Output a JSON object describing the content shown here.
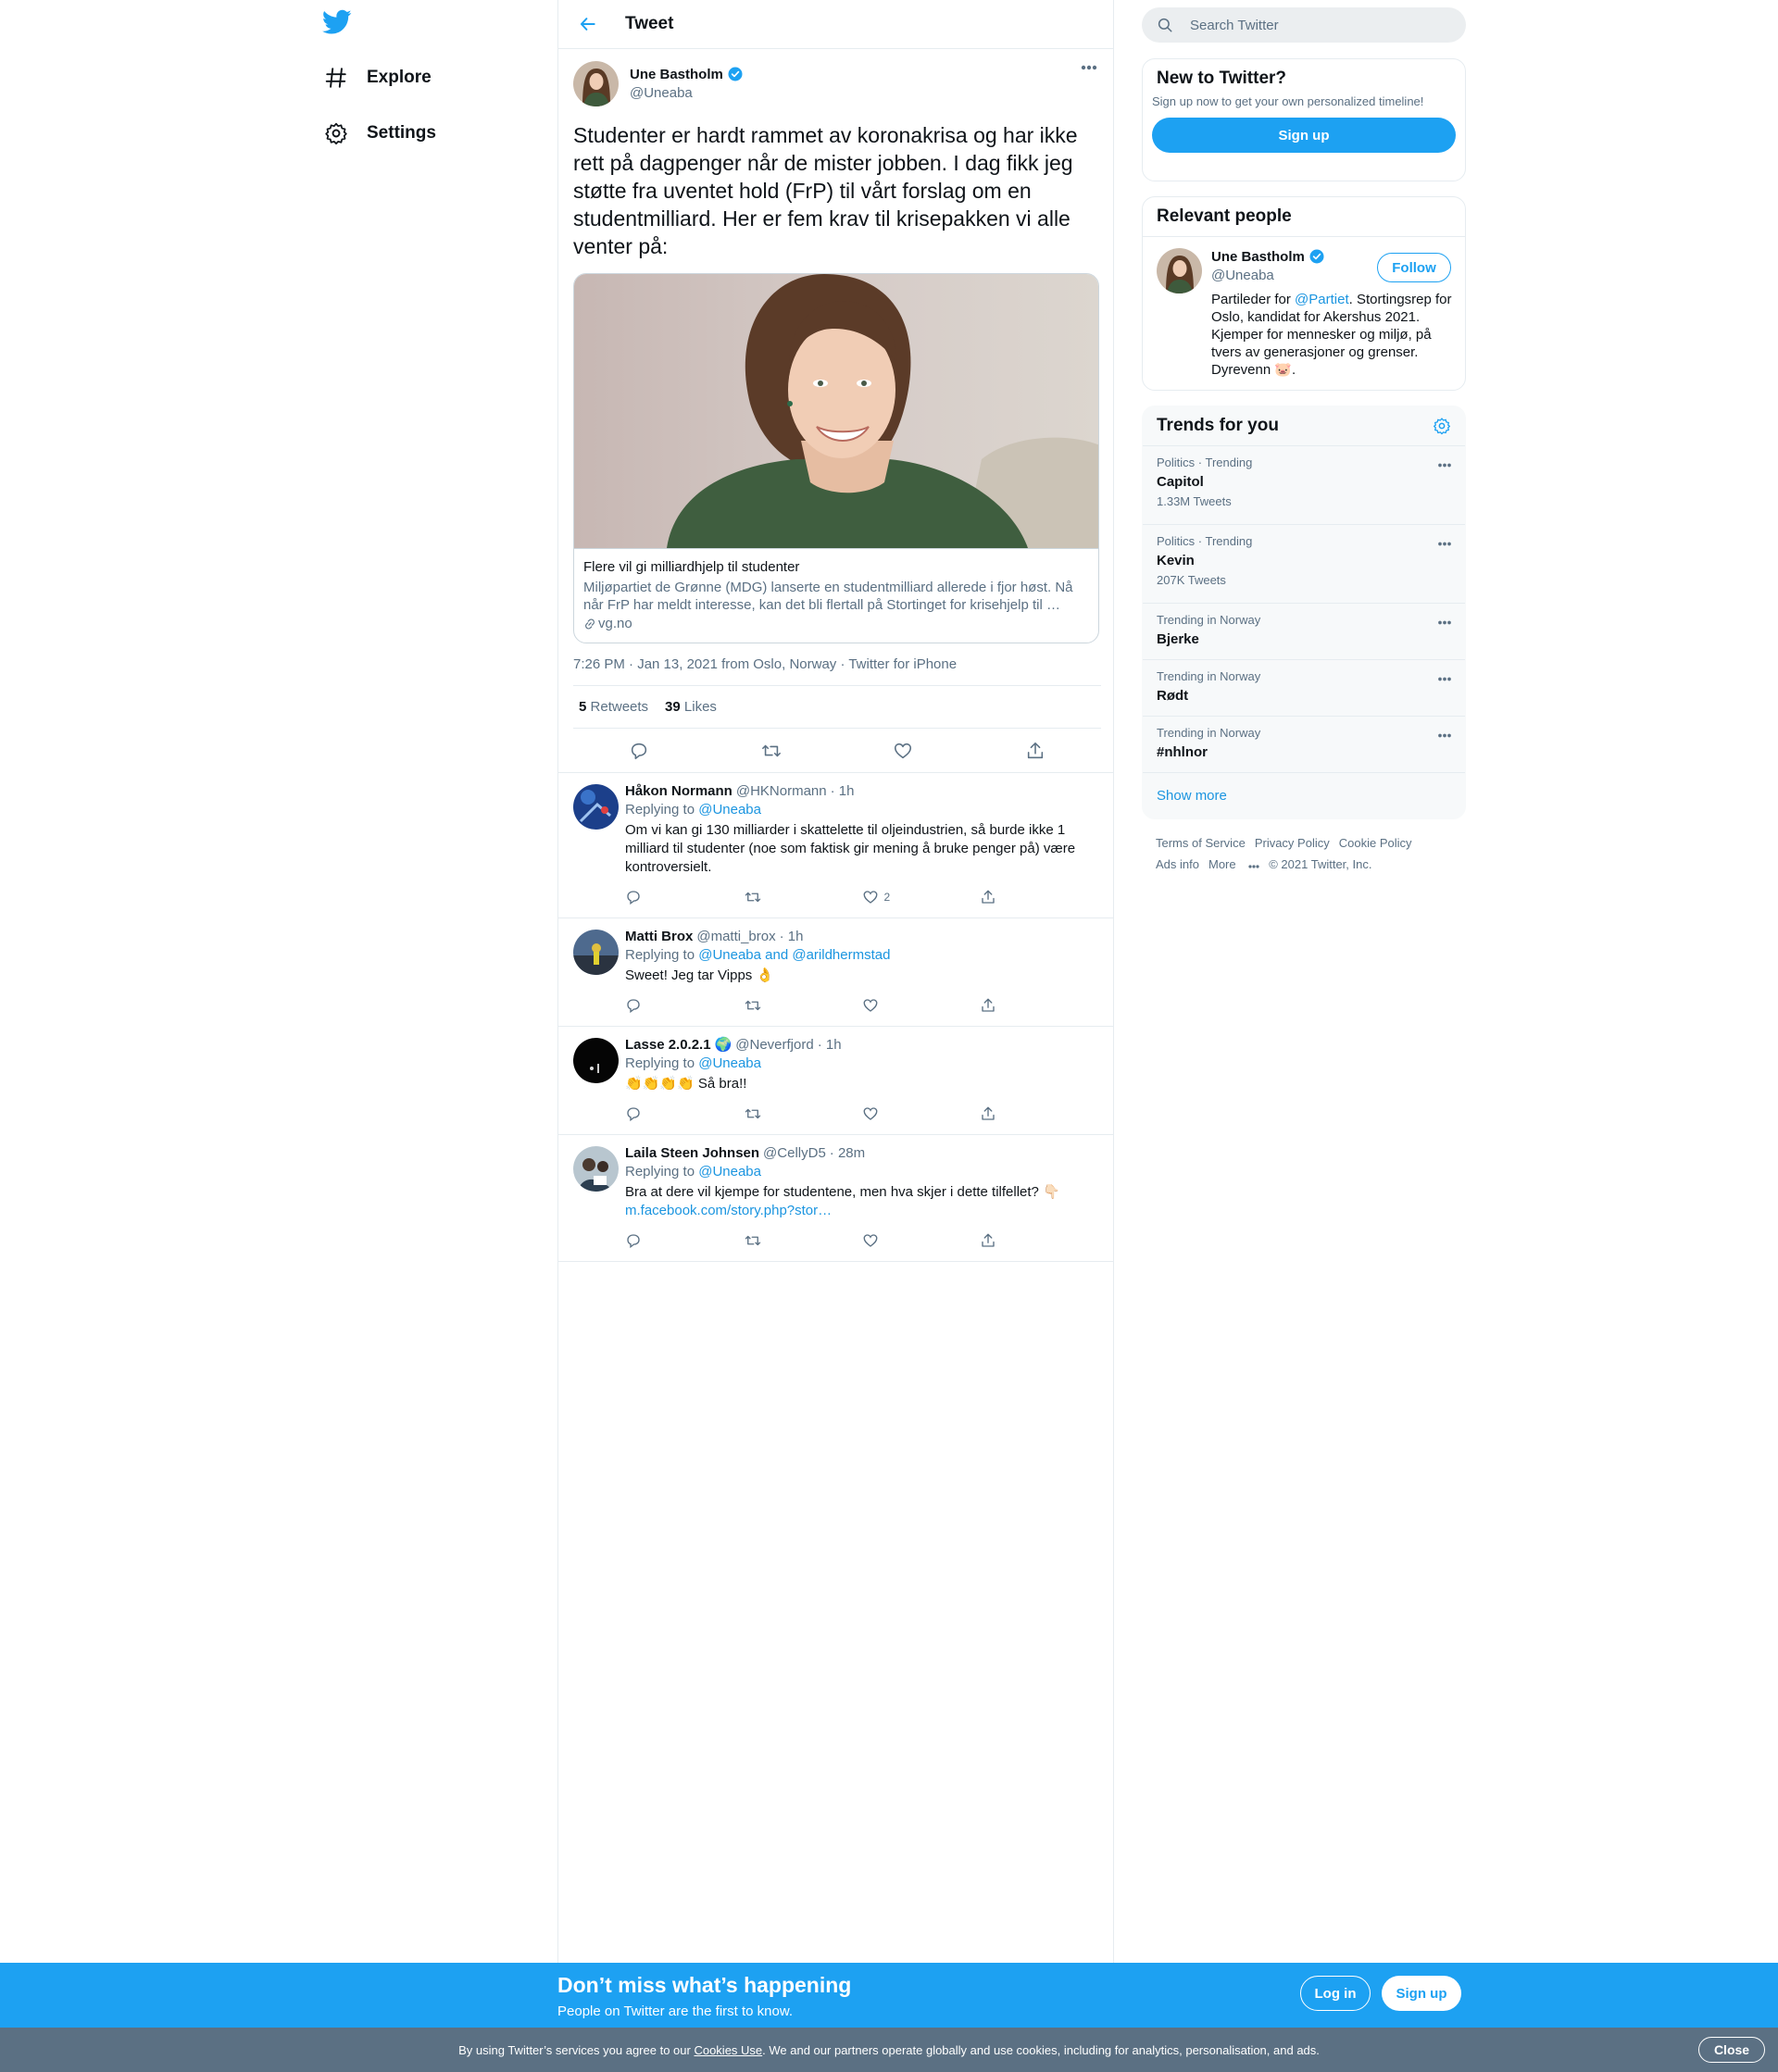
{
  "nav": {
    "logo_icon": "twitter-bird-icon",
    "items": [
      {
        "label": "Explore",
        "icon": "hashtag-icon"
      },
      {
        "label": "Settings",
        "icon": "gear-icon"
      }
    ]
  },
  "main": {
    "header_title": "Tweet",
    "tweet": {
      "author_name": "Une Bastholm",
      "author_handle": "@Uneaba",
      "text": "Studenter er hardt rammet av koronakrisa og har ikke rett på dagpenger når de mister jobben. I dag fikk jeg støtte fra uventet hold (FrP) til vårt forslag om en studentmilliard. Her er fem krav til krisepakken vi alle venter på:",
      "card": {
        "title": "Flere vil gi milliardhjelp til studenter",
        "description": "Miljøpartiet de Grønne (MDG) lanserte en studentmilliard allerede i fjor høst. Nå når FrP har meldt interesse, kan det bli flertall på Stortinget for krisehjelp til …",
        "domain": "vg.no"
      },
      "timestamp": "7:26 PM · Jan 13, 2021 from Oslo, Norway · Twitter for iPhone",
      "retweets_count": "5",
      "retweets_label": "Retweets",
      "likes_count": "39",
      "likes_label": "Likes"
    },
    "replies": [
      {
        "name": "Håkon Normann",
        "handle": "@HKNormann",
        "time": "· 1h",
        "replying_label": "Replying to",
        "replying_to": "@Uneaba",
        "text": "Om vi kan gi 130 milliarder i skattelette til oljeindustrien, så burde ikke 1 milliard til studenter (noe som faktisk gir mening å bruke penger på) være kontroversielt.",
        "like_count": "2"
      },
      {
        "name": "Matti Brox",
        "handle": "@matti_brox",
        "time": "· 1h",
        "replying_label": "Replying to",
        "replying_to": "@Uneaba and @arildhermstad",
        "text": "Sweet! Jeg tar Vipps 👌",
        "like_count": ""
      },
      {
        "name": "Lasse 2.0.2.1",
        "name_emoji": "🌍",
        "handle": "@Neverfjord",
        "time": "· 1h",
        "replying_label": "Replying to",
        "replying_to": "@Uneaba",
        "text": "👏👏👏👏 Så bra!!",
        "like_count": ""
      },
      {
        "name": "Laila Steen Johnsen",
        "handle": "@CellyD5",
        "time": "· 28m",
        "replying_label": "Replying to",
        "replying_to": "@Uneaba",
        "text": "Bra at dere vil kjempe for studentene, men hva skjer i dette tilfellet? 👇🏻",
        "link": "m.facebook.com/story.php?stor…",
        "like_count": ""
      }
    ]
  },
  "sidebar": {
    "search_placeholder": "Search Twitter",
    "new_to_twitter": {
      "title": "New to Twitter?",
      "subtitle": "Sign up now to get your own personalized timeline!",
      "button": "Sign up"
    },
    "relevant_people": {
      "title": "Relevant people",
      "name": "Une Bastholm",
      "handle": "@Uneaba",
      "follow_label": "Follow",
      "bio_before": "Partileder for ",
      "bio_mention": "@Partiet",
      "bio_after": ". Stortingsrep for Oslo, kandidat for Akershus 2021. Kjemper for mennesker og miljø, på tvers av generasjoner og grenser. Dyrevenn 🐷."
    },
    "trends": {
      "title": "Trends for you",
      "items": [
        {
          "category": "Politics · Trending",
          "name": "Capitol",
          "count": "1.33M Tweets"
        },
        {
          "category": "Politics · Trending",
          "name": "Kevin",
          "count": "207K Tweets"
        },
        {
          "category": "Trending in Norway",
          "name": "Bjerke",
          "count": ""
        },
        {
          "category": "Trending in Norway",
          "name": "Rødt",
          "count": ""
        },
        {
          "category": "Trending in Norway",
          "name": "#nhlnor",
          "count": ""
        }
      ],
      "show_more": "Show more"
    },
    "footer": {
      "terms": "Terms of Service",
      "privacy": "Privacy Policy",
      "cookie": "Cookie Policy",
      "ads": "Ads info",
      "more": "More",
      "copyright": "© 2021 Twitter, Inc."
    }
  },
  "banner": {
    "title": "Don’t miss what’s happening",
    "subtitle": "People on Twitter are the first to know.",
    "login": "Log in",
    "signup": "Sign up"
  },
  "cookie_bar": {
    "text_before": "By using Twitter’s services you agree to our ",
    "link": "Cookies Use",
    "text_after": ". We and our partners operate globally and use cookies, including for analytics, personalisation, and ads.",
    "close": "Close"
  },
  "colors": {
    "brand_blue": "#1da1f2",
    "link_blue": "#1b95e0",
    "muted_text": "#5b7083",
    "border": "#e6ecf0"
  }
}
